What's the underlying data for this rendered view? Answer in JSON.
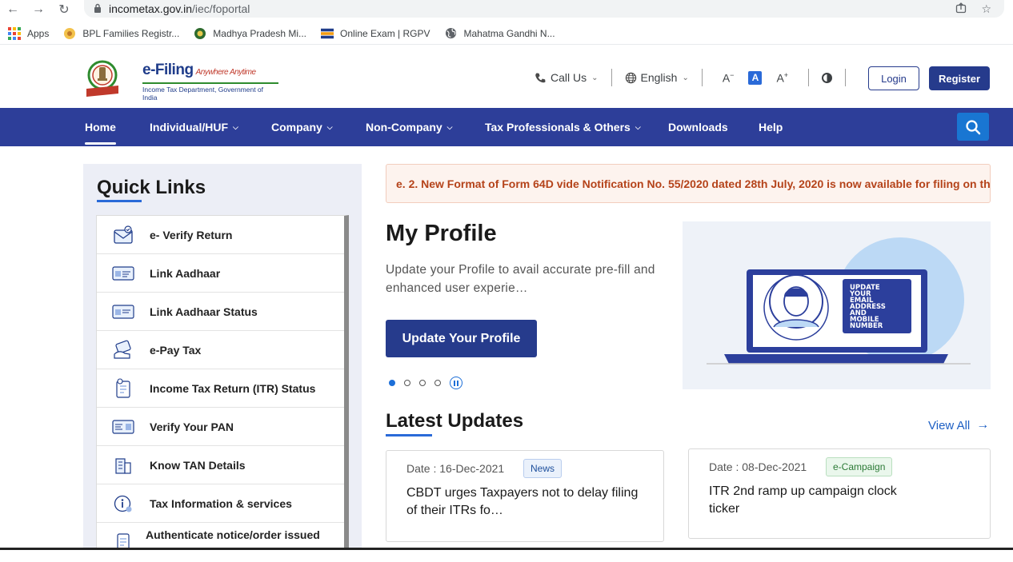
{
  "browser": {
    "url_host": "incometax.gov.in",
    "url_path": "/iec/foportal",
    "bookmarks": [
      {
        "label": "Apps",
        "icon": "apps-grid-icon"
      },
      {
        "label": "BPL Families Registr...",
        "icon": "bookmark-favicon"
      },
      {
        "label": "Madhya Pradesh Mi...",
        "icon": "bookmark-favicon"
      },
      {
        "label": "Online Exam | RGPV",
        "icon": "bookmark-favicon"
      },
      {
        "label": "Mahatma Gandhi N...",
        "icon": "globe-icon"
      }
    ]
  },
  "header": {
    "logo_title": "e-Filing",
    "logo_tagline": "Anywhere Anytime",
    "logo_subtitle": "Income Tax Department, Government of India",
    "call_us": "Call Us",
    "language": "English",
    "font_decrease": "A",
    "font_normal": "A",
    "font_increase": "A",
    "login": "Login",
    "register": "Register"
  },
  "nav": {
    "items": [
      {
        "label": "Home",
        "dropdown": false
      },
      {
        "label": "Individual/HUF",
        "dropdown": true
      },
      {
        "label": "Company",
        "dropdown": true
      },
      {
        "label": "Non-Company",
        "dropdown": true
      },
      {
        "label": "Tax Professionals & Others",
        "dropdown": true
      },
      {
        "label": "Downloads",
        "dropdown": false
      },
      {
        "label": "Help",
        "dropdown": false
      }
    ]
  },
  "quick_links": {
    "title": "Quick Links",
    "items": [
      {
        "label": "e- Verify Return",
        "icon": "verify-return-icon"
      },
      {
        "label": "Link Aadhaar",
        "icon": "aadhaar-card-icon"
      },
      {
        "label": "Link Aadhaar Status",
        "icon": "aadhaar-status-icon"
      },
      {
        "label": "e-Pay Tax",
        "icon": "pay-tax-icon"
      },
      {
        "label": "Income Tax Return (ITR) Status",
        "icon": "itr-status-icon"
      },
      {
        "label": "Verify Your PAN",
        "icon": "pan-card-icon"
      },
      {
        "label": "Know TAN Details",
        "icon": "building-icon"
      },
      {
        "label": "Tax Information & services",
        "icon": "info-icon"
      },
      {
        "label": "Authenticate notice/order issued by ITD",
        "icon": "document-icon"
      }
    ]
  },
  "ticker": {
    "text": "e. 2. New Format of Form 64D vide Notification No. 55/2020 dated 28th July, 2020 is now available for filing on the portal"
  },
  "profile": {
    "title": "My Profile",
    "description": "Update your Profile to avail accurate pre-fill and enhanced user experie…",
    "button": "Update Your Profile",
    "visual_text": [
      "UPDATE",
      "YOUR",
      "EMAIL",
      "ADDRESS",
      "AND",
      "MOBILE",
      "NUMBER"
    ],
    "slides_total": 4,
    "active_slide": 1
  },
  "latest_updates": {
    "title": "Latest Updates",
    "view_all": "View All",
    "cards": [
      {
        "date": "Date : 16-Dec-2021",
        "badge": "News",
        "headline": "CBDT urges Taxpayers not to delay filing of their ITRs fo…"
      },
      {
        "date": "Date : 08-Dec-2021",
        "badge": "e-Campaign",
        "headline": "ITR 2nd ramp up campaign clock ticker"
      }
    ]
  },
  "colors": {
    "nav_bg": "#2d3e99",
    "primary_button": "#263b8c",
    "search_button": "#1976d2",
    "ticker_text": "#b5431a",
    "link": "#1d5fc4"
  }
}
